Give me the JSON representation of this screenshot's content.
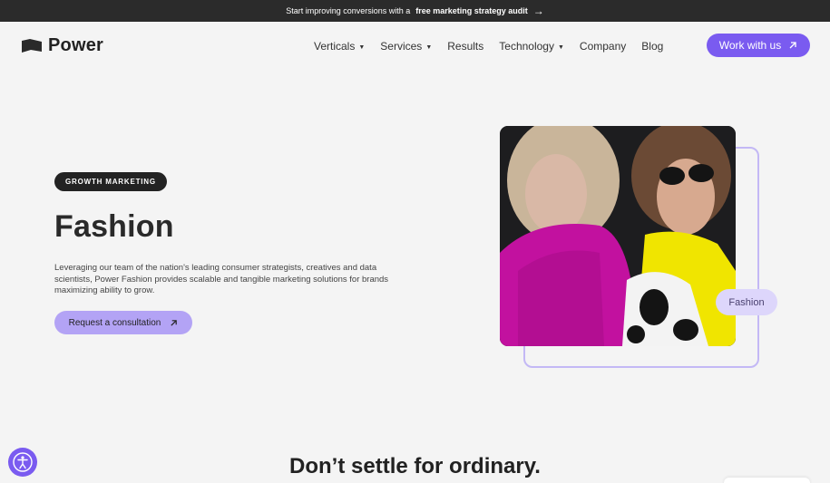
{
  "announcement": {
    "prefix": "Start improving conversions with a",
    "bold": "free marketing strategy audit",
    "arrow": "→"
  },
  "brand": {
    "name": "Power",
    "icon": "flag-logo-icon"
  },
  "nav": {
    "items": [
      {
        "label": "Verticals",
        "dropdown": true
      },
      {
        "label": "Services",
        "dropdown": true
      },
      {
        "label": "Results",
        "dropdown": false
      },
      {
        "label": "Technology",
        "dropdown": true
      },
      {
        "label": "Company",
        "dropdown": false
      },
      {
        "label": "Blog",
        "dropdown": false
      }
    ],
    "cta_label": "Work with us"
  },
  "hero": {
    "badge": "GROWTH MARKETING",
    "title": "Fashion",
    "description": "Leveraging our team of the nation's leading consumer strategists, creatives and data scientists, Power Fashion provides scalable and tangible marketing solutions for brands maximizing ability to grow.",
    "button_label": "Request a consultation",
    "image_tag": "Fashion"
  },
  "section": {
    "title": "Don’t settle for ordinary."
  },
  "colors": {
    "accent": "#7a5bf0",
    "accent_light": "#b3a3f5",
    "dark": "#2b2b2b",
    "background": "#f4f4f4"
  }
}
